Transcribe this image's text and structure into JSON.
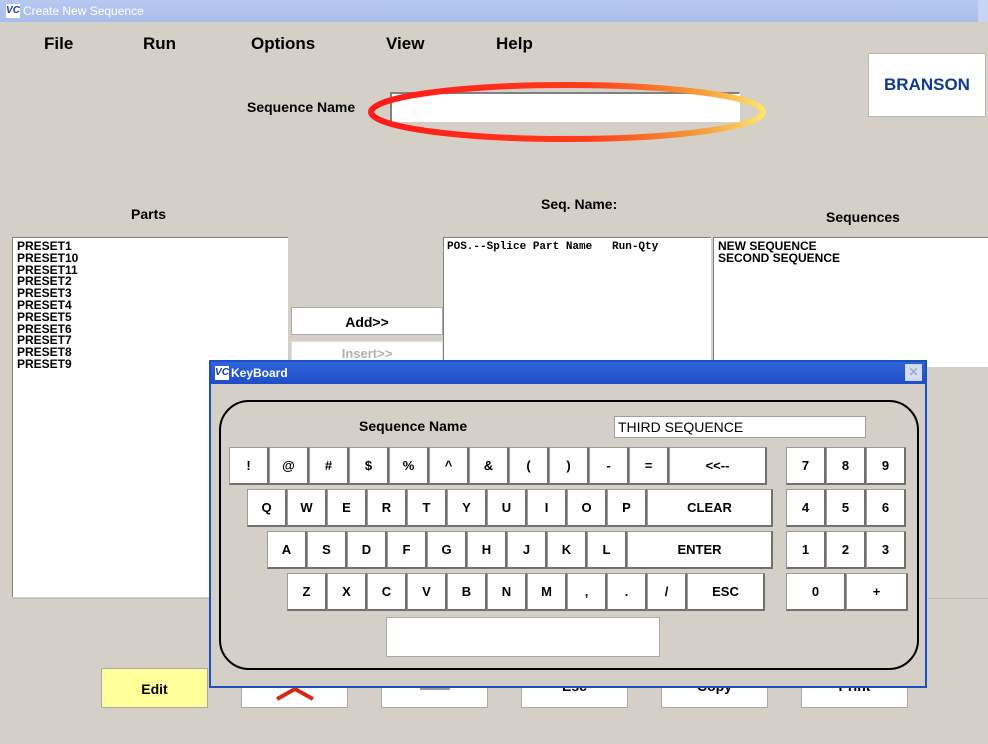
{
  "window": {
    "title": "Create New Sequence",
    "app_icon": "VC"
  },
  "menu": [
    "File",
    "Run",
    "Options",
    "View",
    "Help"
  ],
  "brand": "BRANSON",
  "sequence_name_label": "Sequence Name",
  "sequence_name_value": "",
  "parts": {
    "header": "Parts",
    "items": [
      "PRESET1",
      "PRESET10",
      "PRESET11",
      "PRESET2",
      "PRESET3",
      "PRESET4",
      "PRESET5",
      "PRESET6",
      "PRESET7",
      "PRESET8",
      "PRESET9"
    ]
  },
  "seq_panel": {
    "header": "Seq. Name:",
    "columns": "POS.--Splice Part Name   Run-Qty"
  },
  "sequences": {
    "header": "Sequences",
    "items": [
      "NEW SEQUENCE",
      "SECOND SEQUENCE"
    ]
  },
  "buttons": {
    "add": "Add>>",
    "insert": "Insert>>",
    "edit": "Edit",
    "esc": "Esc",
    "copy": "Copy",
    "print": "Print"
  },
  "keyboard": {
    "title": "KeyBoard",
    "field_label": "Sequence Name",
    "field_value": "THIRD SEQUENCE",
    "row1": [
      "!",
      "@",
      "#",
      "$",
      "%",
      "^",
      "&",
      "(",
      ")",
      "-",
      "=",
      "<<--"
    ],
    "row2": [
      "Q",
      "W",
      "E",
      "R",
      "T",
      "Y",
      "U",
      "I",
      "O",
      "P",
      "CLEAR"
    ],
    "row3": [
      "A",
      "S",
      "D",
      "F",
      "G",
      "H",
      "J",
      "K",
      "L",
      "ENTER"
    ],
    "row4": [
      "Z",
      "X",
      "C",
      "V",
      "B",
      "N",
      "M",
      ",",
      ".",
      "/",
      "ESC"
    ],
    "numpad": [
      "7",
      "8",
      "9",
      "4",
      "5",
      "6",
      "1",
      "2",
      "3",
      "0",
      "+"
    ]
  },
  "colors": {
    "title_active": "#245edb",
    "edit_button": "#ffff99",
    "highlight_ring_start": "#ff1a1a",
    "highlight_ring_end": "#ffe36b",
    "brand": "#0d3c8e"
  },
  "icons": {
    "window": "app-vc-icon",
    "close": "close-icon",
    "up": "up-arrow-icon",
    "left": "left-arrow-icon"
  }
}
